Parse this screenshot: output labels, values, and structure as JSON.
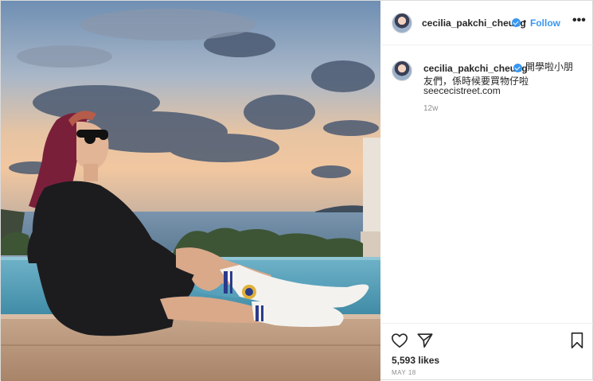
{
  "post": {
    "image_alt": "Woman in sunglasses and black dress sitting on a ledge by an infinity pool at sunset"
  },
  "header": {
    "username": "cecilia_pakchi_cheung",
    "separator": "•",
    "follow_label": "Follow",
    "more_label": "•••"
  },
  "caption": {
    "username": "cecilia_pakchi_cheung",
    "text_line1": "開學啦小朋",
    "text_line2": "友們，係時候要買物仔啦",
    "link": "seececistreet.com",
    "age": "12w"
  },
  "actions": {
    "likes": "5,593 likes",
    "date": "MAY 18"
  },
  "colors": {
    "accent": "#3897f0",
    "text": "#262626",
    "muted": "#8e8e8e",
    "border": "#dbdbdb"
  },
  "icons": [
    "heart-icon",
    "share-icon",
    "bookmark-icon",
    "verified-badge-icon",
    "more-icon"
  ]
}
